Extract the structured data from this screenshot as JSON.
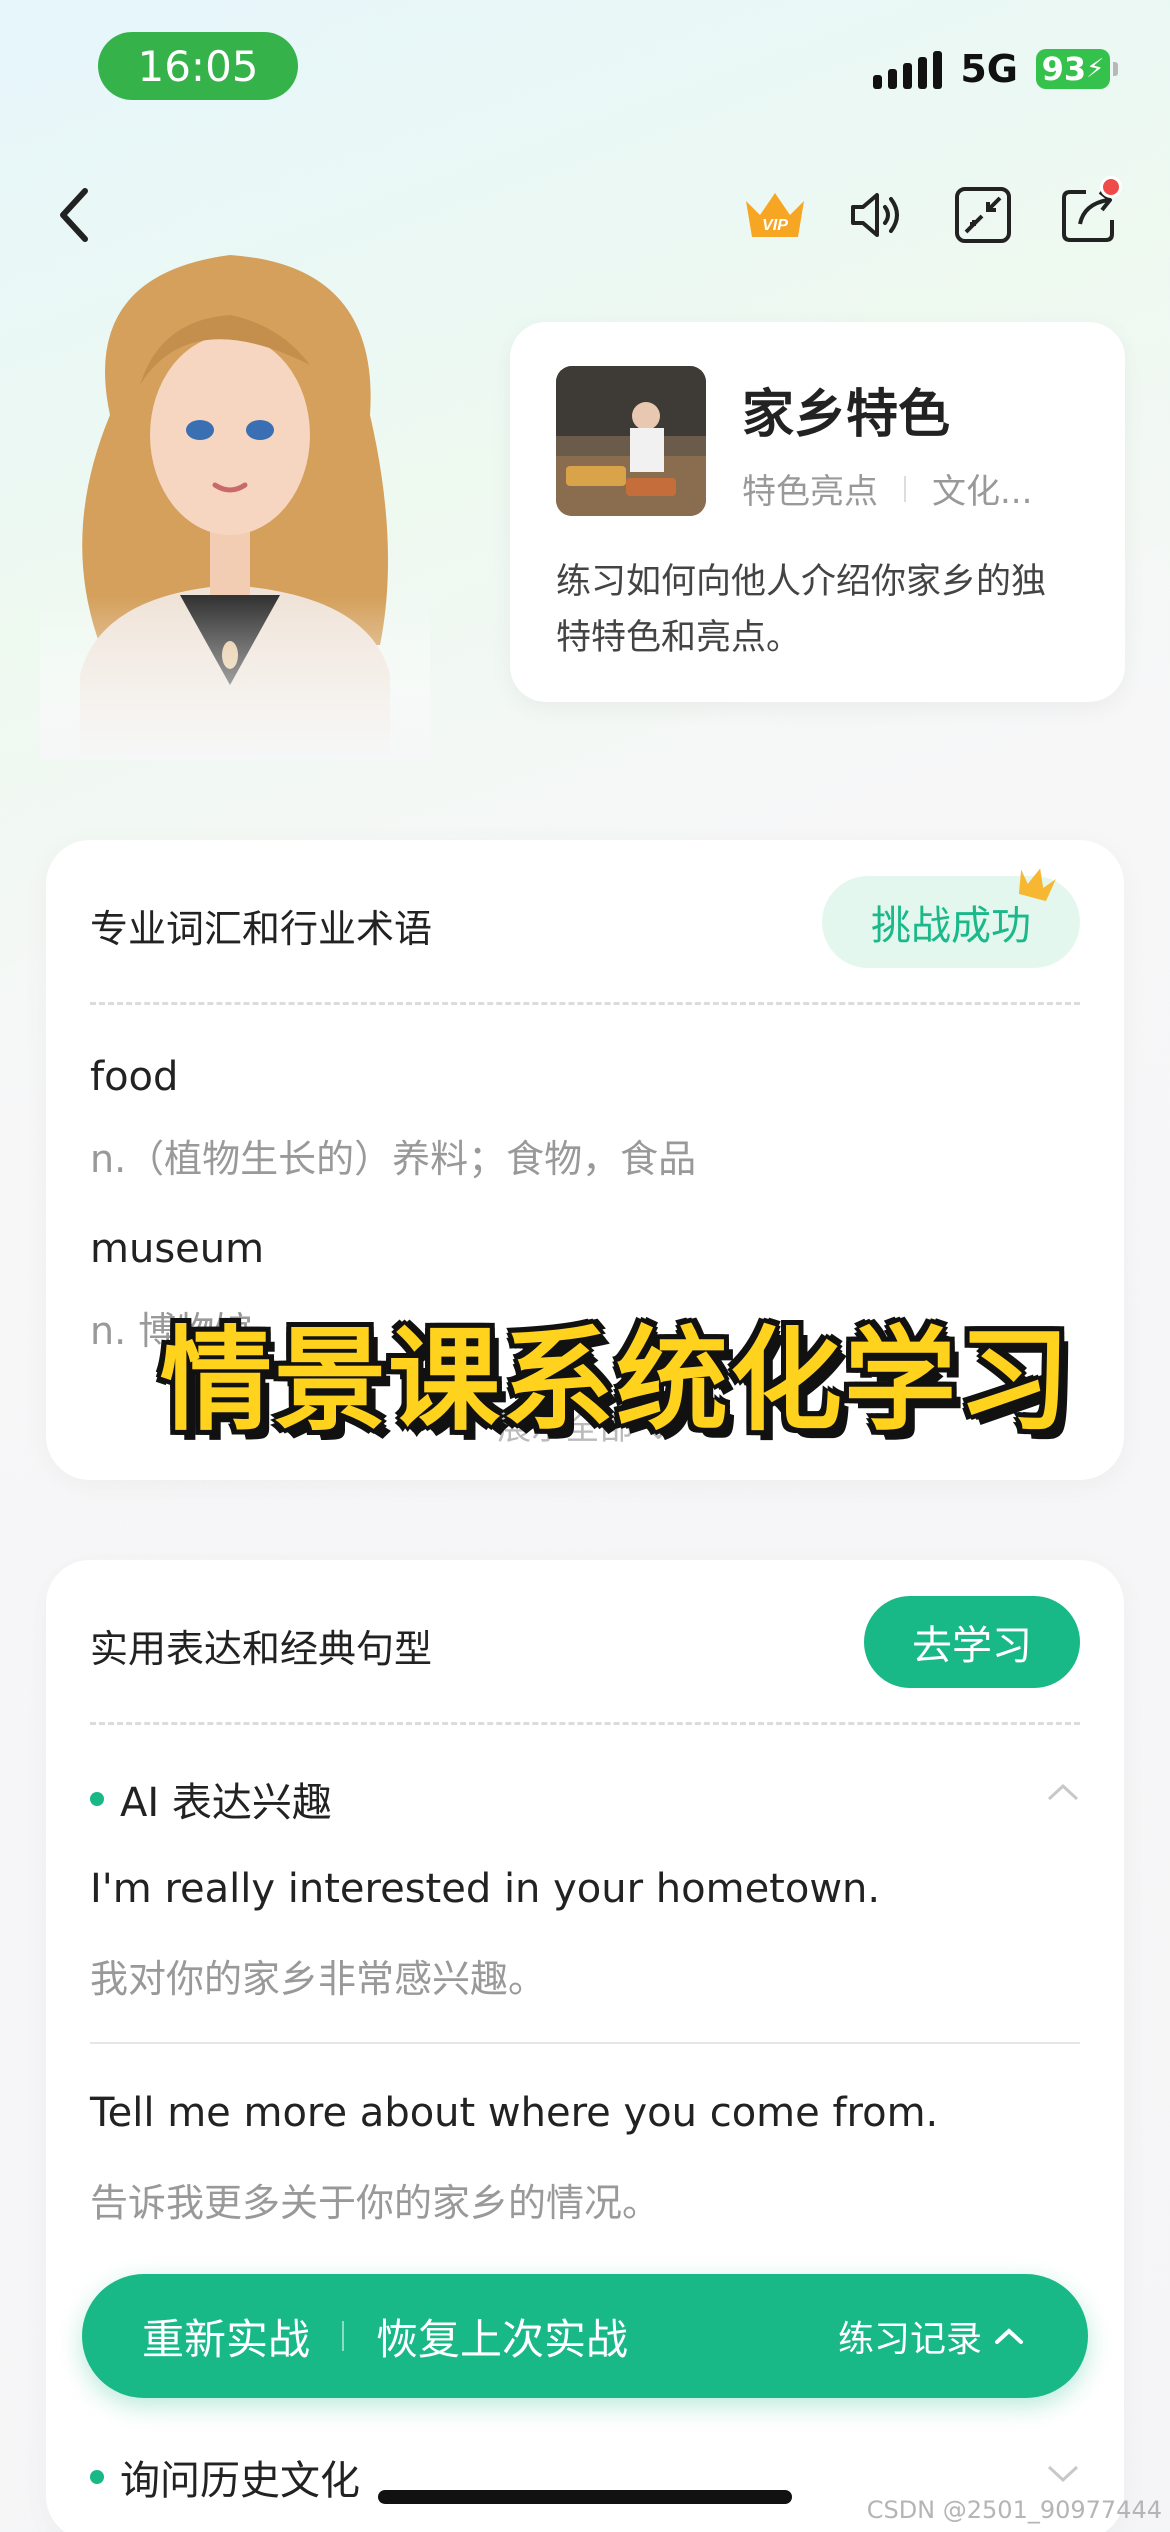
{
  "status_bar": {
    "time": "16:05",
    "network": "5G",
    "battery": "93"
  },
  "nav": {
    "icons": [
      "back-icon",
      "vip-crown-icon",
      "volume-icon",
      "shrink-icon",
      "share-icon"
    ]
  },
  "scene": {
    "title": "家乡特色",
    "tags": [
      "特色亮点",
      "文化..."
    ],
    "description": "练习如何向他人介绍你家乡的独特特色和亮点。"
  },
  "vocab_card": {
    "title": "专业词汇和行业术语",
    "badge": "挑战成功",
    "words": [
      {
        "word": "food",
        "meaning": "n.（植物生长的）养料；食物，食品"
      },
      {
        "word": "museum",
        "meaning": "n. 博物馆"
      }
    ],
    "expand_label": "展示全部"
  },
  "overlay_text": "情景课系统化学习",
  "expr_card": {
    "title": "实用表达和经典句型",
    "learn_button": "去学习",
    "sections": [
      {
        "title": "AI 表达兴趣",
        "sentences": [
          {
            "en": "I'm really interested in your hometown.",
            "zh": "我对你的家乡非常感兴趣。"
          },
          {
            "en": "Tell me more about where you come from.",
            "zh": "告诉我更多关于你的家乡的情况。"
          }
        ]
      },
      {
        "title": "询问历史文化",
        "sentences": []
      }
    ]
  },
  "action_bar": {
    "restart": "重新实战",
    "resume": "恢复上次实战",
    "record": "练习记录"
  },
  "watermark": "CSDN @2501_90977444",
  "colors": {
    "accent": "#19b887",
    "time_pill": "#35b34a",
    "overlay": "#ffd21e"
  }
}
